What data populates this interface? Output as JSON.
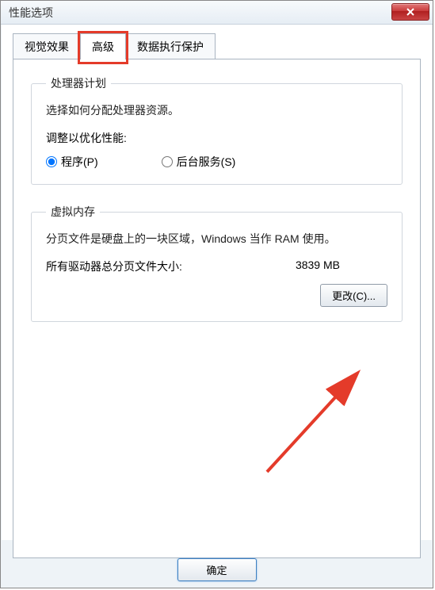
{
  "titlebar": {
    "title": "性能选项"
  },
  "tabs": {
    "visual": "视觉效果",
    "advanced": "高级",
    "dep": "数据执行保护"
  },
  "processor": {
    "legend": "处理器计划",
    "desc": "选择如何分配处理器资源。",
    "adjust_label": "调整以优化性能:",
    "programs": "程序(P)",
    "background": "后台服务(S)"
  },
  "vmem": {
    "legend": "虚拟内存",
    "desc": "分页文件是硬盘上的一块区域，Windows 当作 RAM 使用。",
    "total_label": "所有驱动器总分页文件大小:",
    "total_value": "3839 MB",
    "change_btn": "更改(C)..."
  },
  "footer": {
    "ok": "确定"
  }
}
